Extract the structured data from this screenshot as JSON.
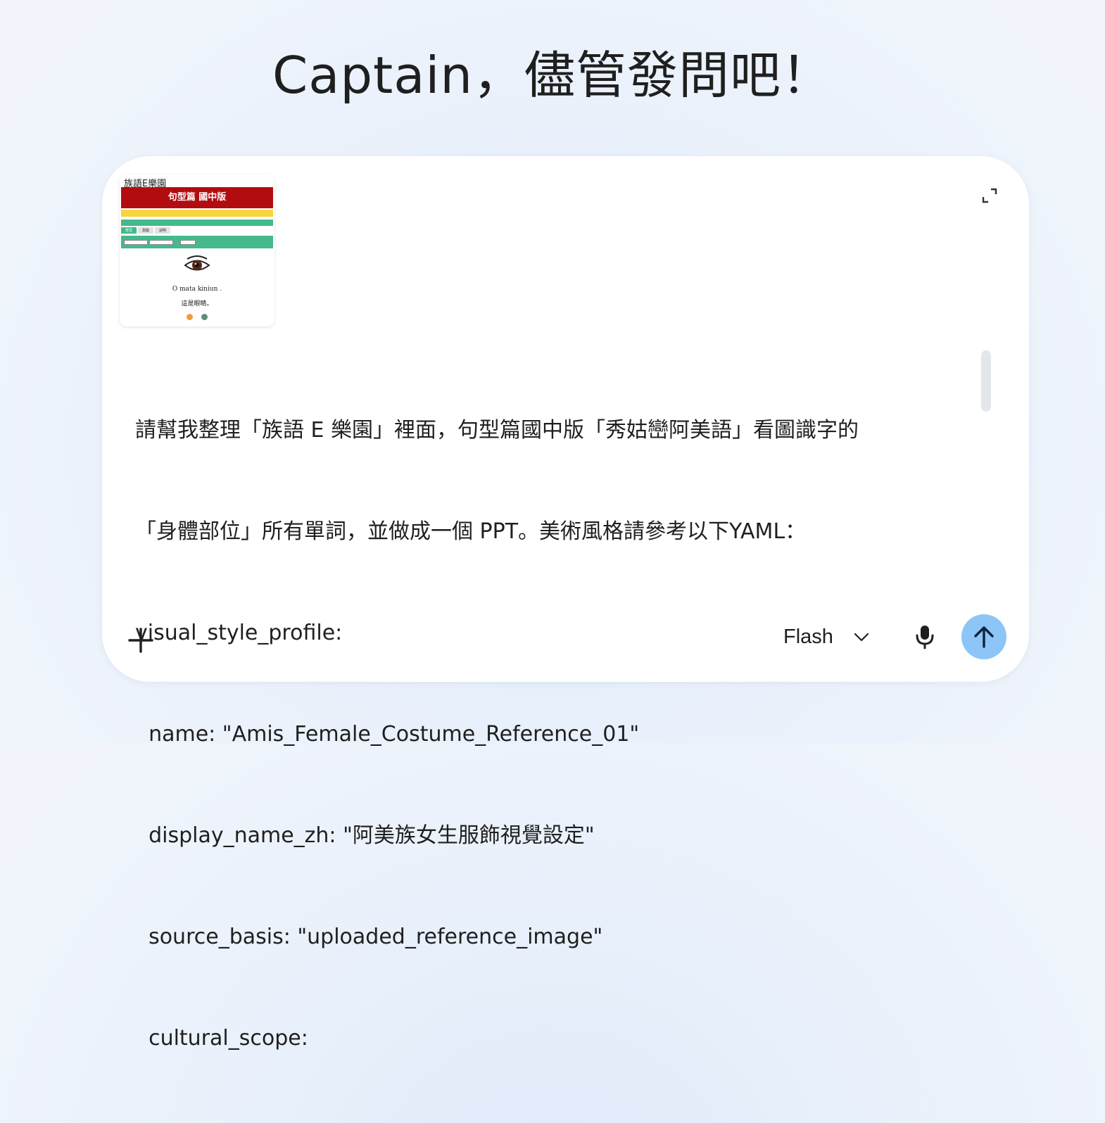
{
  "greeting": "Captain，儘管發問吧！",
  "attachment": {
    "logo_text": "族語E樂園",
    "banner_text": "句型篇 國中版",
    "caption_line1": "O mata kiniun .",
    "caption_line2": "這是眼睛。",
    "tab_labels": [
      "學習",
      "測驗",
      "說明"
    ]
  },
  "prompt": {
    "lines": [
      "請幫我整理「族語 E 樂園」裡面，句型篇國中版「秀姑巒阿美語」看圖識字的",
      "「身體部位」所有單詞，並做成一個 PPT。美術風格請參考以下YAML：",
      "visual_style_profile:",
      "  name: \"Amis_Female_Costume_Reference_01\"",
      "  display_name_zh: \"阿美族女生服飾視覺設定\"",
      "  source_basis: \"uploaded_reference_image\"",
      "  cultural_scope:"
    ]
  },
  "toolbar": {
    "model_label": "Flash"
  },
  "colors": {
    "send_button": "#8ec5f7",
    "banner_red": "#b20c10",
    "accent_green": "#43b98c"
  }
}
